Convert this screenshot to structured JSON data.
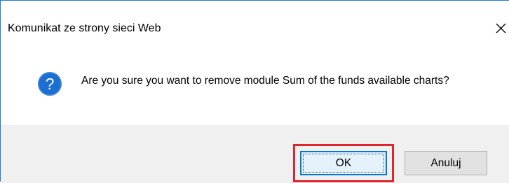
{
  "dialog": {
    "title": "Komunikat ze strony sieci Web",
    "close_glyph": "X",
    "message": "Are you sure you want to remove module Sum of the funds available charts?",
    "icon": "question-icon",
    "buttons": {
      "ok_label": "OK",
      "cancel_label": "Anuluj"
    }
  },
  "colors": {
    "title_border": "#1e78d6",
    "icon_blue": "#1c6fd1",
    "footer_bg": "#f0f0f0",
    "ok_border": "#0078d7",
    "highlight": "#e0252e"
  }
}
